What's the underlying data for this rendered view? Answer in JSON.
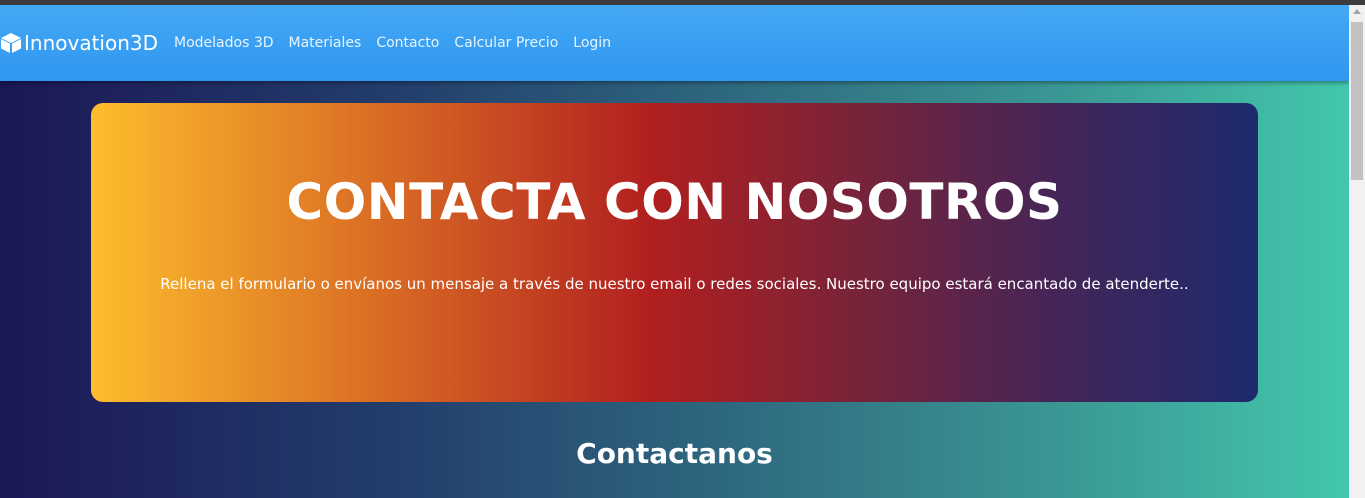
{
  "navbar": {
    "brand": "Innovation3D",
    "brand_icon": "cube-icon",
    "links": [
      "Modelados 3D",
      "Materiales",
      "Contacto",
      "Calcular Precio",
      "Login"
    ]
  },
  "hero": {
    "title": "CONTACTA CON NOSOTROS",
    "text": "Rellena el formulario o envíanos un mensaje a través de nuestro email o redes sociales. Nuestro equipo estará encantado de atenderte.."
  },
  "section": {
    "title": "Contactanos"
  },
  "colors": {
    "navbar": "#3aa0f3",
    "hero_start": "#fdbd2d",
    "hero_mid": "#b11f1f",
    "hero_end": "#1d2a6d",
    "page_start": "#1b1756",
    "page_end": "#43c7ac"
  }
}
